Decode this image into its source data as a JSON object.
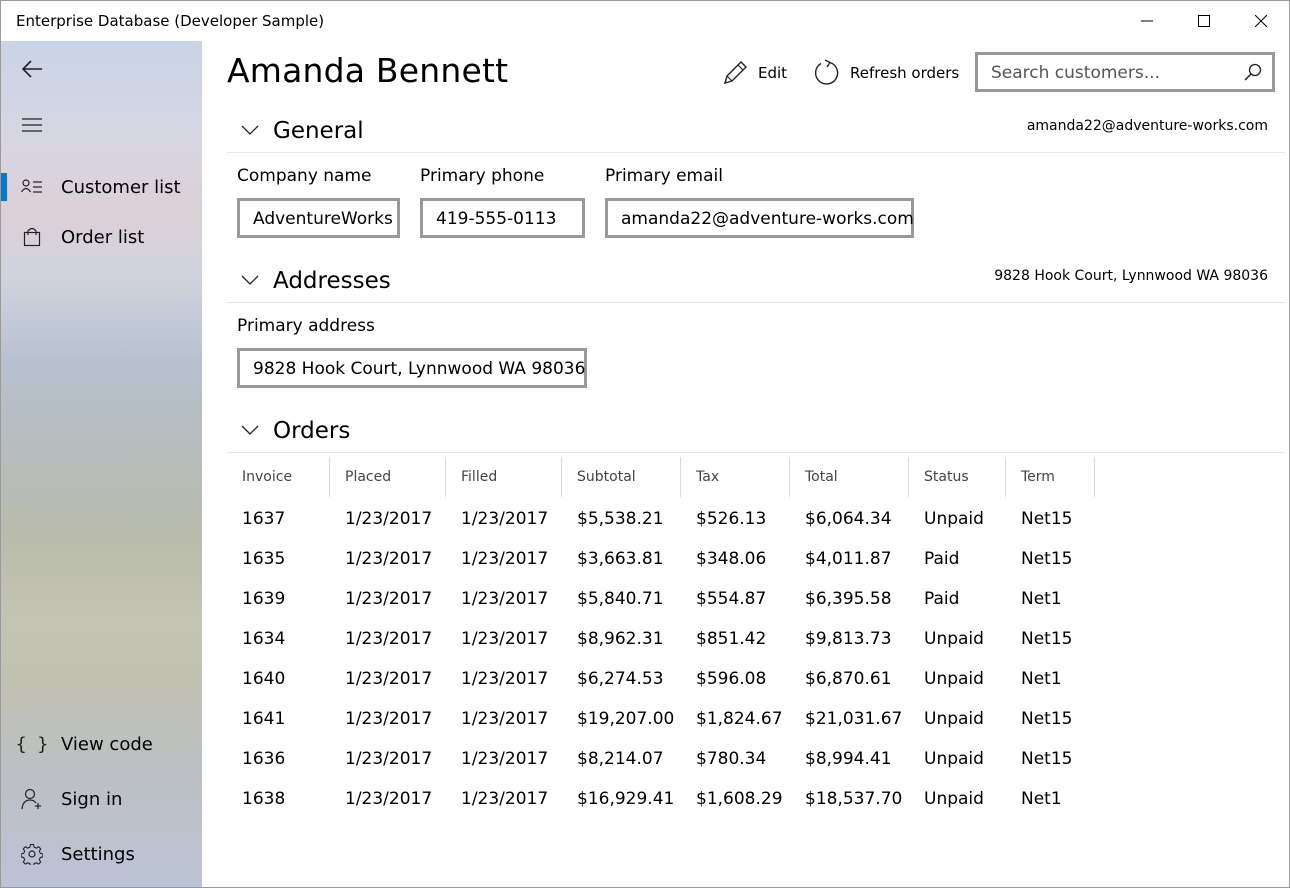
{
  "window": {
    "title": "Enterprise Database (Developer Sample)"
  },
  "nav": {
    "items": [
      {
        "label": "Customer list",
        "icon": "customer-list-icon",
        "selected": true
      },
      {
        "label": "Order list",
        "icon": "shopping-bag-icon",
        "selected": false
      }
    ],
    "footer": [
      {
        "label": "View code",
        "icon": "braces-icon"
      },
      {
        "label": "Sign in",
        "icon": "add-person-icon"
      },
      {
        "label": "Settings",
        "icon": "gear-icon"
      }
    ]
  },
  "header": {
    "customer_name": "Amanda Bennett",
    "edit_label": "Edit",
    "refresh_label": "Refresh orders",
    "search_placeholder": "Search customers..."
  },
  "general": {
    "title": "General",
    "summary": "amanda22@adventure-works.com",
    "company_label": "Company name",
    "company_value": "AdventureWorks",
    "phone_label": "Primary phone",
    "phone_value": "419-555-0113",
    "email_label": "Primary email",
    "email_value": "amanda22@adventure-works.com"
  },
  "addresses": {
    "title": "Addresses",
    "summary": "9828 Hook Court, Lynnwood WA 98036",
    "primary_label": "Primary address",
    "primary_value": "9828 Hook Court, Lynnwood WA 98036"
  },
  "orders": {
    "title": "Orders",
    "columns": [
      "Invoice",
      "Placed",
      "Filled",
      "Subtotal",
      "Tax",
      "Total",
      "Status",
      "Term"
    ],
    "rows": [
      [
        "1637",
        "1/23/2017",
        "1/23/2017",
        "$5,538.21",
        "$526.13",
        "$6,064.34",
        "Unpaid",
        "Net15"
      ],
      [
        "1635",
        "1/23/2017",
        "1/23/2017",
        "$3,663.81",
        "$348.06",
        "$4,011.87",
        "Paid",
        "Net15"
      ],
      [
        "1639",
        "1/23/2017",
        "1/23/2017",
        "$5,840.71",
        "$554.87",
        "$6,395.58",
        "Paid",
        "Net1"
      ],
      [
        "1634",
        "1/23/2017",
        "1/23/2017",
        "$8,962.31",
        "$851.42",
        "$9,813.73",
        "Unpaid",
        "Net15"
      ],
      [
        "1640",
        "1/23/2017",
        "1/23/2017",
        "$6,274.53",
        "$596.08",
        "$6,870.61",
        "Unpaid",
        "Net1"
      ],
      [
        "1641",
        "1/23/2017",
        "1/23/2017",
        "$19,207.00",
        "$1,824.67",
        "$21,031.67",
        "Unpaid",
        "Net15"
      ],
      [
        "1636",
        "1/23/2017",
        "1/23/2017",
        "$8,214.07",
        "$780.34",
        "$8,994.41",
        "Unpaid",
        "Net15"
      ],
      [
        "1638",
        "1/23/2017",
        "1/23/2017",
        "$16,929.41",
        "$1,608.29",
        "$18,537.70",
        "Unpaid",
        "Net1"
      ]
    ]
  },
  "colors": {
    "accent": "#0078d7",
    "input_border": "#999999"
  }
}
